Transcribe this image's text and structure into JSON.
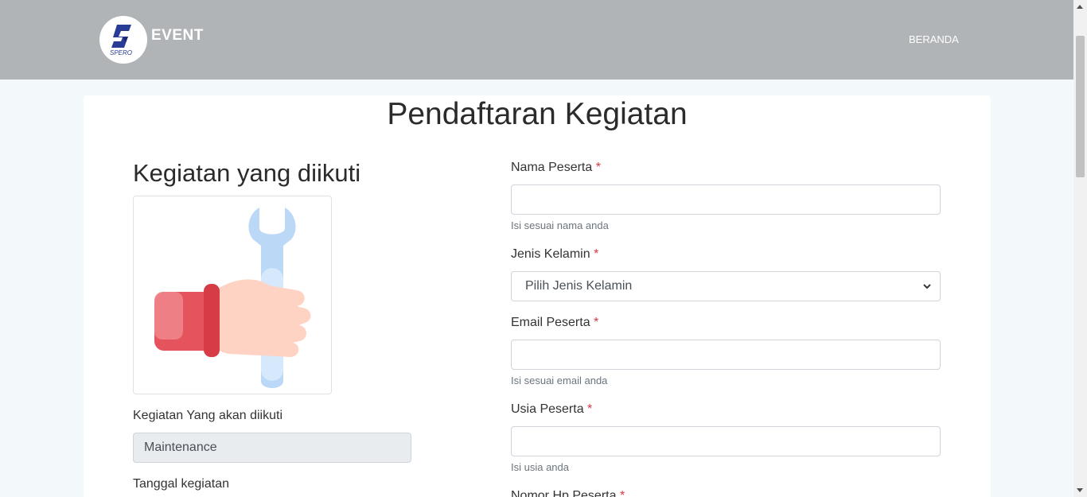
{
  "nav": {
    "brand": "EVENT",
    "logo_text": "SPERO",
    "home_link": "BERANDA"
  },
  "page": {
    "title": "Pendaftaran Kegiatan"
  },
  "left": {
    "section_title": "Kegiatan yang diikuti",
    "activity_label": "Kegiatan Yang akan diikuti",
    "activity_value": "Maintenance",
    "date_label": "Tanggal kegiatan"
  },
  "form": {
    "required_mark": "*",
    "name_label": "Nama Peserta",
    "name_help": "Isi sesuai nama anda",
    "gender_label": "Jenis Kelamin",
    "gender_selected": "Pilih Jenis Kelamin",
    "email_label": "Email Peserta",
    "email_help": "Isi sesuai email anda",
    "age_label": "Usia Peserta",
    "age_help": "Isi usia anda",
    "phone_label": "Nomor Hp Peserta"
  },
  "colors": {
    "navbar": "#b0b4b7",
    "required": "#dc3545",
    "background": "#f3f8fb"
  }
}
